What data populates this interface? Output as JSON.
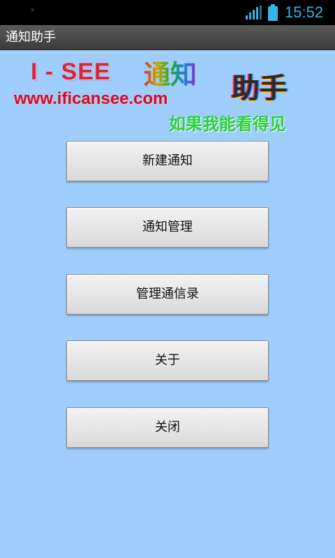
{
  "status_bar": {
    "time": "15:52",
    "signal_icon": "signal-icon",
    "battery_icon": "battery-icon",
    "accent_color": "#33b5e5"
  },
  "app": {
    "title": "通知助手"
  },
  "banner": {
    "brand": "I - SEE",
    "word_notify": "通知",
    "word_helper": "助手",
    "url": "www.ificansee.com",
    "slogan": "如果我能看得见"
  },
  "menu": {
    "new_notice": "新建通知",
    "manage_notice": "通知管理",
    "manage_contacts": "管理通信录",
    "about": "关于",
    "close": "关闭"
  },
  "colors": {
    "background": "#9fcdfc",
    "title_bar": "#4a4a4a",
    "url_red": "#c8102e",
    "slogan_green": "#2bd13b"
  }
}
